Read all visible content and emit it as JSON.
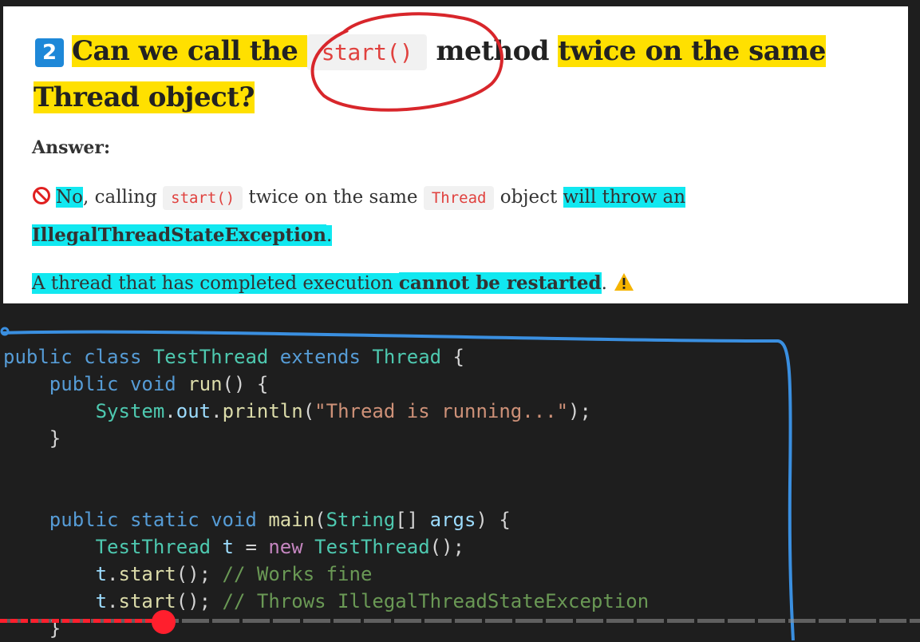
{
  "question": {
    "number": "2",
    "part1": "Can we call the ",
    "code": "start()",
    "part2": " method ",
    "part3": "twice",
    "part4": " on the same Thread object?"
  },
  "answer": {
    "label": "Answer:",
    "line1_no": "No",
    "line1_a": ", calling ",
    "line1_code1": "start()",
    "line1_b": " twice on the same ",
    "line1_code2": "Thread",
    "line1_c": " object ",
    "line1_d": "will throw an",
    "line2": "IllegalThreadStateException",
    "line2_end": ".",
    "line3_a": "A thread that has completed execution ",
    "line3_b": "cannot be restarted",
    "line3_end": "."
  },
  "code": {
    "l1_a": "public class ",
    "l1_b": "TestThread",
    "l1_c": " extends ",
    "l1_d": "Thread",
    "l1_e": " {",
    "l2_a": "    public void ",
    "l2_b": "run",
    "l2_c": "() {",
    "l3_a": "        ",
    "l3_b": "System",
    "l3_c": ".",
    "l3_d": "out",
    "l3_e": ".",
    "l3_f": "println",
    "l3_g": "(",
    "l3_h": "\"Thread is running...\"",
    "l3_i": ");",
    "l4": "    }",
    "l7_a": "    public static void ",
    "l7_b": "main",
    "l7_c": "(",
    "l7_d": "String",
    "l7_e": "[] ",
    "l7_f": "args",
    "l7_g": ") {",
    "l8_a": "        ",
    "l8_b": "TestThread",
    "l8_c": " t",
    "l8_d": " = ",
    "l8_e": "new",
    "l8_f": " ",
    "l8_g": "TestThread",
    "l8_h": "();",
    "l9_a": "        ",
    "l9_b": "t",
    "l9_c": ".",
    "l9_d": "start",
    "l9_e": "(); ",
    "l9_f": "// Works fine",
    "l10_a": "        ",
    "l10_b": "t",
    "l10_c": ".",
    "l10_d": "start",
    "l10_e": "(); ",
    "l10_f": "// Throws IllegalThreadStateException",
    "l11": "    }"
  },
  "player": {
    "progress_fraction": 0.178
  },
  "colors": {
    "yellow_highlight": "#ffe000",
    "cyan_highlight": "#11e8f0",
    "progress_red": "#ff1f2d"
  }
}
